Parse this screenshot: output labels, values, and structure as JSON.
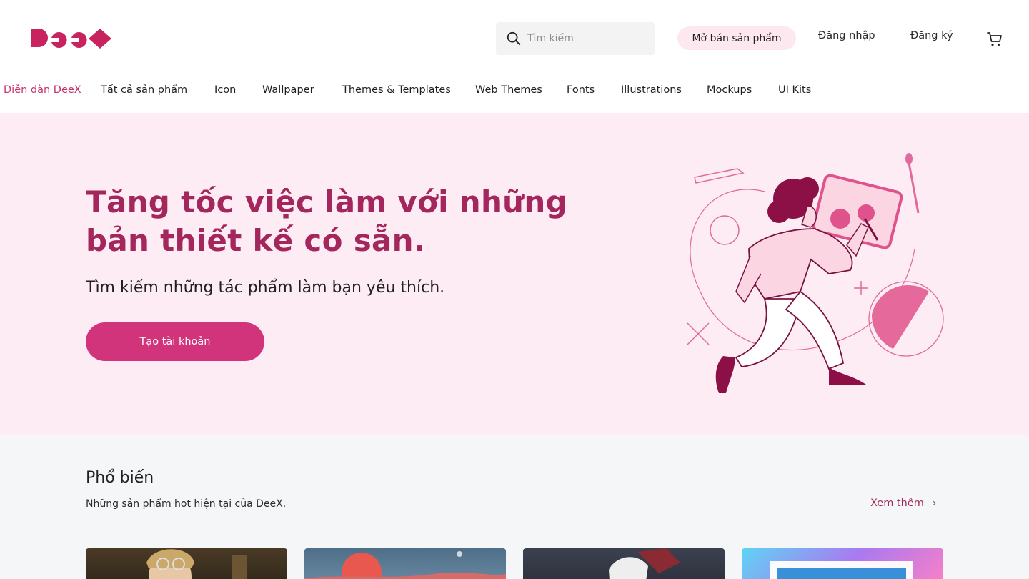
{
  "header": {
    "logo_text": "DeeX",
    "search_placeholder": "Tìm kiếm",
    "sell_label": "Mở bán sản phẩm",
    "login_label": "Đăng nhập",
    "register_label": "Đăng ký"
  },
  "menu": {
    "items": [
      {
        "label": "Diễn đàn DeeX",
        "active": true
      },
      {
        "label": "Tất cả sản phẩm"
      },
      {
        "label": "Icon"
      },
      {
        "label": "Wallpaper"
      },
      {
        "label": "Themes & Templates"
      },
      {
        "label": "Web Themes"
      },
      {
        "label": "Fonts"
      },
      {
        "label": "Illustrations"
      },
      {
        "label": "Mockups"
      },
      {
        "label": "UI Kits"
      }
    ]
  },
  "hero": {
    "title": "Tăng tốc việc làm với những bản thiết kế có sẵn.",
    "subtitle": "Tìm kiếm những tác phẩm làm bạn yêu thích.",
    "cta_label": "Tạo tài khoản"
  },
  "popular": {
    "title": "Phổ biến",
    "subtitle": "Những sản phẩm hot hiện tại của DeeX.",
    "more_label": "Xem thêm",
    "cards": [
      {
        "name": "anime-portrait-thumbnail"
      },
      {
        "name": "sunset-landscape-thumbnail"
      },
      {
        "name": "anime-character-thumbnail"
      },
      {
        "name": "poster-text-thumbnail"
      }
    ]
  },
  "colors": {
    "brand": "#c8235f",
    "accent": "#d2347b",
    "hero_bg": "#fdecf3",
    "title": "#a3275d"
  }
}
